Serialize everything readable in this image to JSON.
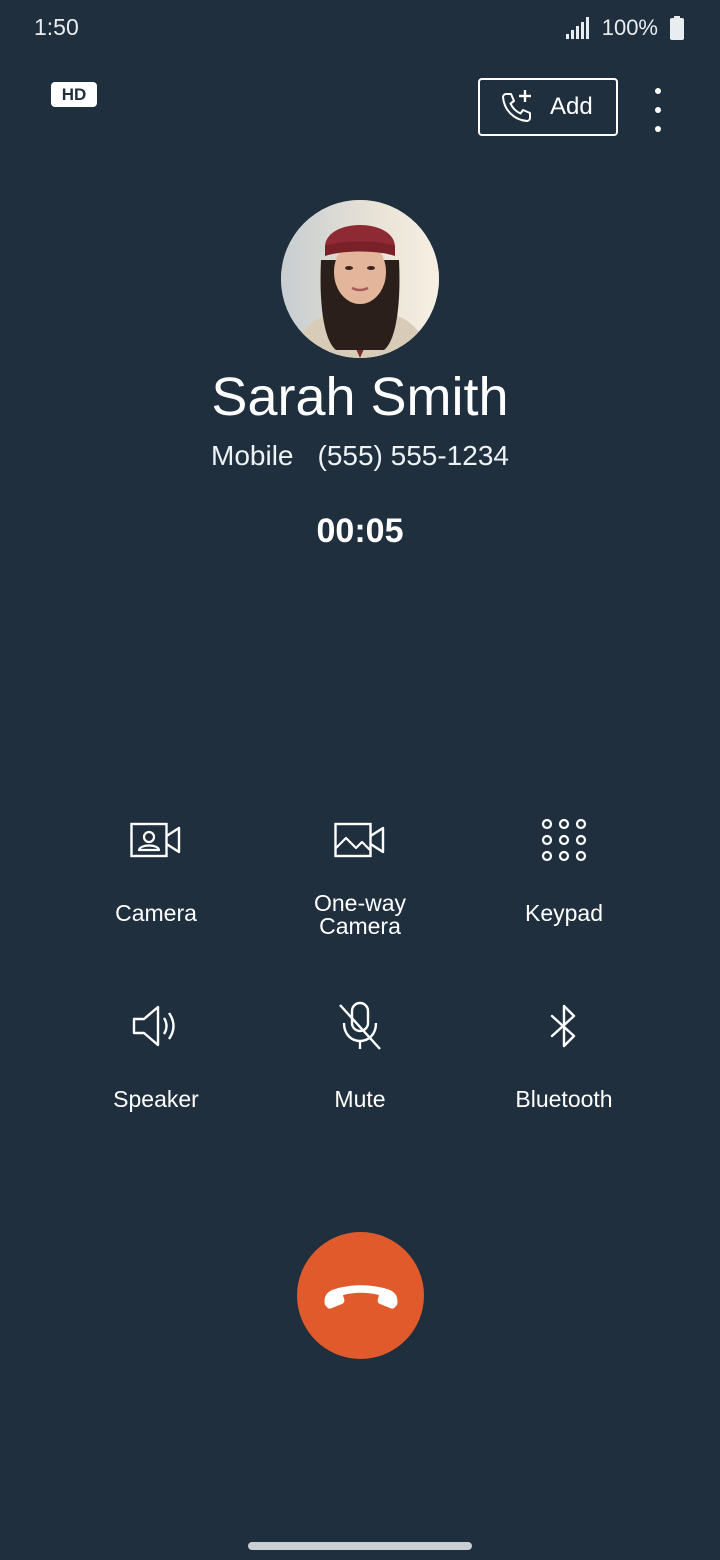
{
  "status_bar": {
    "time": "1:50",
    "battery": "100%"
  },
  "hd_badge": "HD",
  "add_button": {
    "label": "Add"
  },
  "contact": {
    "name": "Sarah Smith",
    "type": "Mobile",
    "number": "(555) 555-1234",
    "timer": "00:05"
  },
  "controls": {
    "camera": "Camera",
    "oneway_line1": "One-way",
    "oneway_line2": "Camera",
    "keypad": "Keypad",
    "speaker": "Speaker",
    "mute": "Mute",
    "bluetooth": "Bluetooth"
  },
  "colors": {
    "background": "#1f2f3e",
    "end_call": "#e05a2b"
  }
}
